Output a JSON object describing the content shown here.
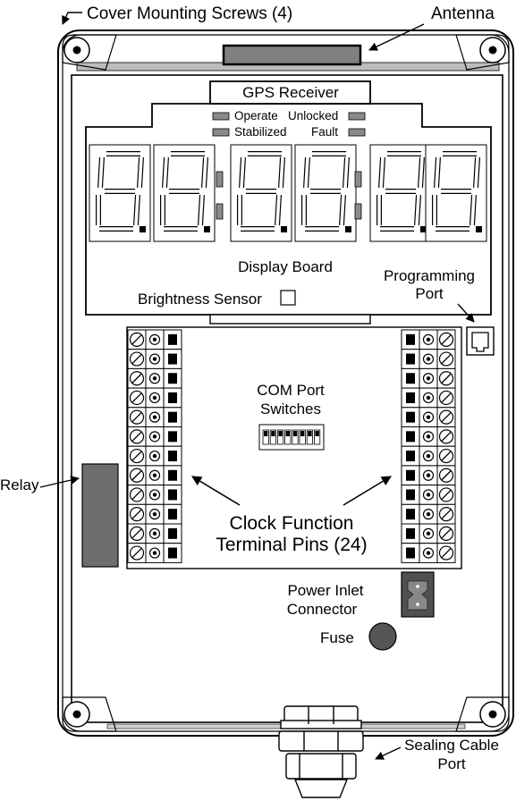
{
  "labels": {
    "cover_screws": "Cover Mounting Screws (4)",
    "antenna": "Antenna",
    "gps_receiver": "GPS Receiver",
    "operate": "Operate",
    "unlocked": "Unlocked",
    "stabilized": "Stabilized",
    "fault": "Fault",
    "display_board": "Display Board",
    "programming_port_1": "Programming",
    "programming_port_2": "Port",
    "brightness_sensor": "Brightness Sensor",
    "com_port_1": "COM Port",
    "com_port_2": "Switches",
    "relay": "Relay",
    "clock_function_1": "Clock Function",
    "clock_function_2": "Terminal Pins (24)",
    "power_inlet_1": "Power Inlet",
    "power_inlet_2": "Connector",
    "fuse": "Fuse",
    "sealing_port_1": "Sealing Cable",
    "sealing_port_2": "Port"
  },
  "display": {
    "digit_count": 6,
    "digit_glyph": "8."
  },
  "terminals": {
    "rows_per_block": 12,
    "blocks": 2
  },
  "dip_switches": 8,
  "colors": {
    "relay": "#6d6d6d",
    "indicator": "#8a8a8a",
    "fuse": "#555555",
    "power_connector": "#505050",
    "antenna_bar": "#808080",
    "lid_strip": "#bdbdbd"
  }
}
